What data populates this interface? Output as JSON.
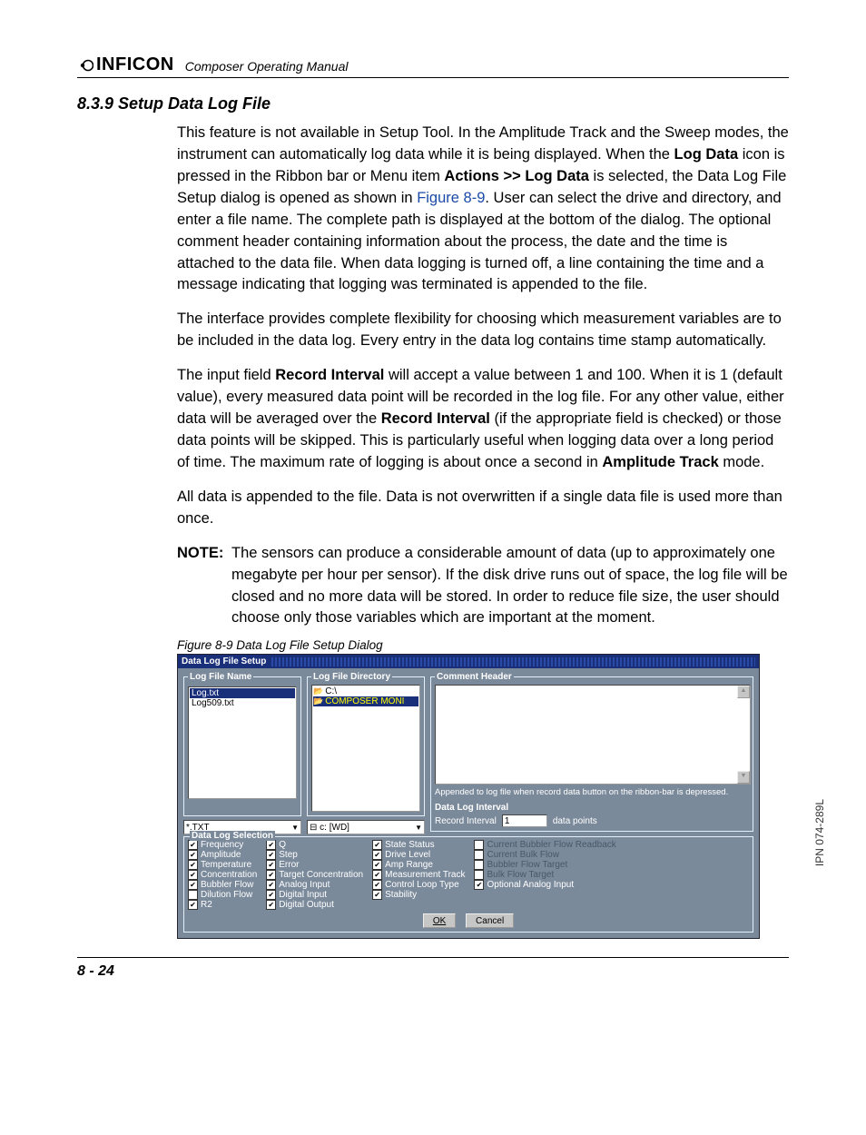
{
  "header": {
    "brand": "INFICON",
    "manual": "Composer Operating Manual"
  },
  "side_label": "IPN 074-289L",
  "section": {
    "number_title": "8.3.9  Setup Data Log File",
    "p1a": "This feature is not available in Setup Tool. In the Amplitude Track and the Sweep modes, the instrument can automatically log data while it is being displayed. When the ",
    "p1b": "Log Data",
    "p1c": " icon is pressed in the Ribbon bar or Menu item ",
    "p1d": "Actions >> Log Data",
    "p1e": " is selected, the Data Log File Setup dialog is opened as shown in ",
    "p1f": "Figure 8-9",
    "p1g": ". User can select the drive and directory, and enter a file name. The complete path is displayed at the bottom of the dialog. The optional comment header containing information about the process, the date and the time is attached to the data file. When data logging is turned off, a line containing the time and a message indicating that logging was terminated is appended to the file.",
    "p2": "The interface provides complete flexibility for choosing which measurement variables are to be included in the data log. Every entry in the data log contains time stamp automatically.",
    "p3a": "The input field ",
    "p3b": "Record Interval",
    "p3c": " will accept a value between 1 and 100. When it is 1 (default value), every measured data point will be recorded in the log file. For any other value, either data will be averaged over the ",
    "p3d": "Record Interval",
    "p3e": " (if the appropriate field is checked) or those data points will be skipped. This is particularly useful when logging data over a long period of time. The maximum rate of logging is about once a second in ",
    "p3f": "Amplitude Track",
    "p3g": " mode.",
    "p4": "All data is appended to the file. Data is not overwritten if a single data file is used more than once.",
    "note_label": "NOTE:",
    "note_body": "The sensors can produce a considerable amount of data (up to approximately one megabyte per hour per sensor). If the disk drive runs out of space, the log file will be closed and no more data will be stored. In order to reduce file size, the user should choose only those variables which are important at the moment.",
    "fig_caption": "Figure 8-9  Data Log File Setup Dialog"
  },
  "dialog": {
    "title": "Data Log File Setup",
    "log_file_name": "Log File Name",
    "files": [
      "Log.txt",
      "Log509.txt"
    ],
    "file_filter": "*.TXT",
    "log_file_dir": "Log File Directory",
    "dirs": [
      "C:\\",
      "COMPOSER MONI"
    ],
    "drive": "c: [WD]",
    "comment_header": "Comment Header",
    "comment_helper": "Appended to log file when record data button on the ribbon-bar is depressed.",
    "data_log_interval": "Data Log Interval",
    "record_interval": "Record Interval",
    "record_value": "1",
    "data_points": "data points",
    "dls_title": "Data Log Selection",
    "col1": [
      {
        "label": "Frequency",
        "checked": true
      },
      {
        "label": "Amplitude",
        "checked": true
      },
      {
        "label": "Temperature",
        "checked": true
      },
      {
        "label": "Concentration",
        "checked": true
      },
      {
        "label": "Bubbler Flow",
        "checked": true
      },
      {
        "label": "Dilution Flow",
        "checked": false
      },
      {
        "label": "R2",
        "checked": true
      }
    ],
    "col2": [
      {
        "label": "Q",
        "checked": true
      },
      {
        "label": "Step",
        "checked": true
      },
      {
        "label": "Error",
        "checked": true
      },
      {
        "label": "Target Concentration",
        "checked": true
      },
      {
        "label": "Analog Input",
        "checked": true
      },
      {
        "label": "Digital Input",
        "checked": true
      },
      {
        "label": "Digital Output",
        "checked": true
      }
    ],
    "col3": [
      {
        "label": "State Status",
        "checked": true
      },
      {
        "label": "Drive Level",
        "checked": true
      },
      {
        "label": "Amp Range",
        "checked": true
      },
      {
        "label": "Measurement Track",
        "checked": true
      },
      {
        "label": "Control Loop Type",
        "checked": true
      },
      {
        "label": "Stability",
        "checked": true
      }
    ],
    "col4": [
      {
        "label": "Current Bubbler Flow Readback",
        "checked": false,
        "dim": true
      },
      {
        "label": "Current Bulk Flow",
        "checked": false,
        "dim": true
      },
      {
        "label": "Bubbler Flow Target",
        "checked": false,
        "dim": true
      },
      {
        "label": "Bulk Flow Target",
        "checked": false,
        "dim": true
      },
      {
        "label": "Optional Analog Input",
        "checked": true
      }
    ],
    "ok": "OK",
    "cancel": "Cancel"
  },
  "footer": "8 - 24"
}
